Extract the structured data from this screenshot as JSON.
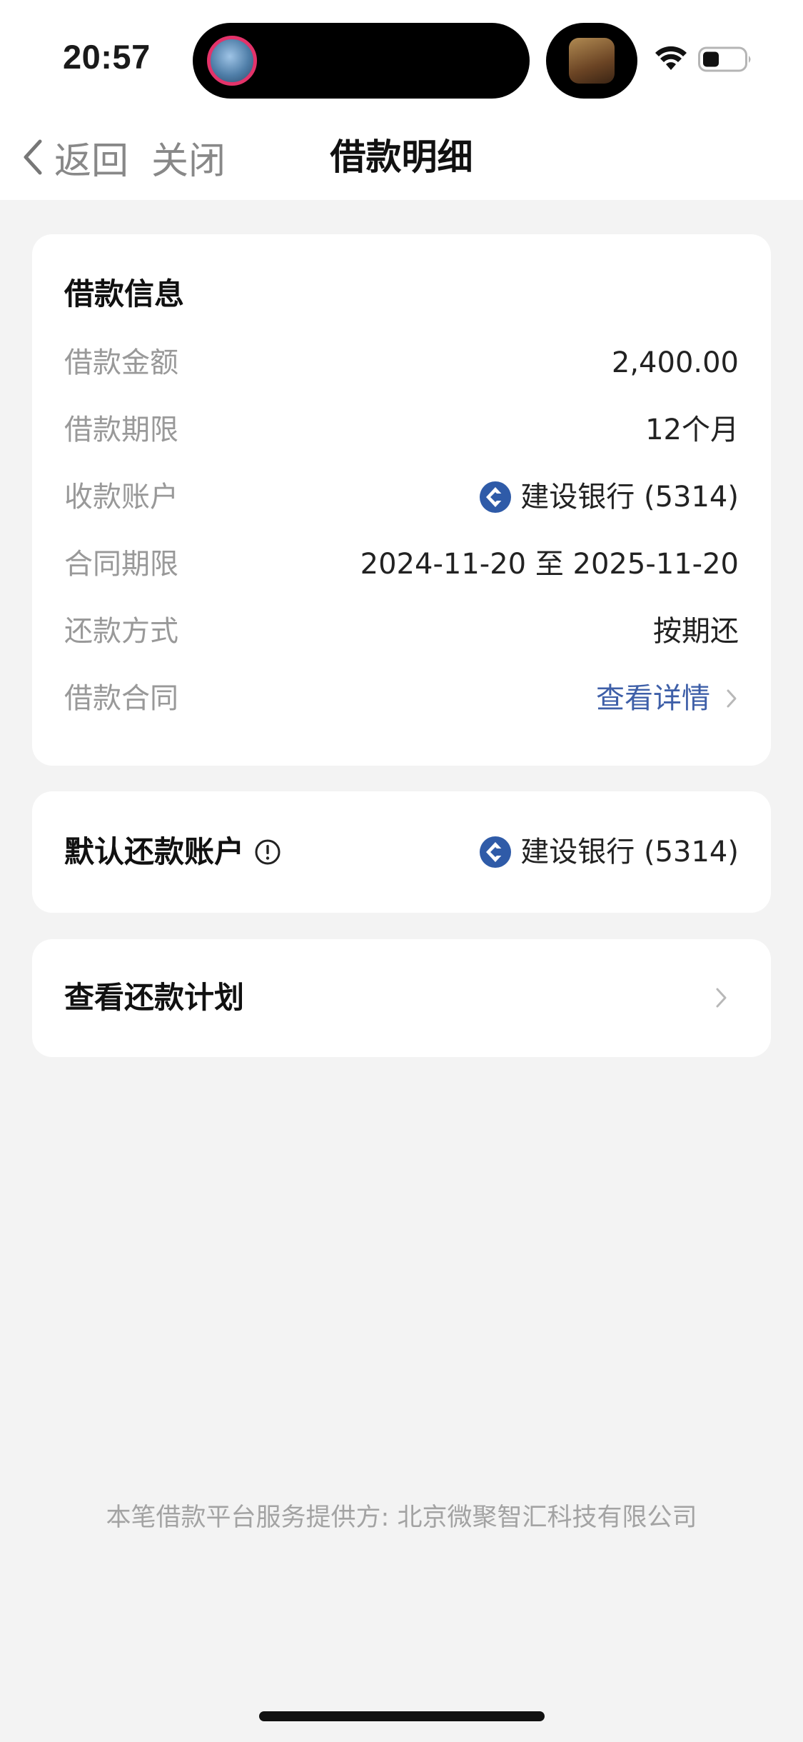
{
  "status_bar": {
    "time": "20:57"
  },
  "nav": {
    "back_label": "返回",
    "close_label": "关闭",
    "title": "借款明细"
  },
  "loan_info": {
    "title": "借款信息",
    "rows": [
      {
        "label": "借款金额",
        "value": "2,400.00"
      },
      {
        "label": "借款期限",
        "value": "12个月"
      },
      {
        "label": "收款账户",
        "value": "建设银行 (5314)",
        "icon": "ccb-bank-logo-icon"
      },
      {
        "label": "合同期限",
        "value": "2024-11-20 至 2025-11-20"
      },
      {
        "label": "还款方式",
        "value": "按期还"
      },
      {
        "label": "借款合同",
        "value": "查看详情",
        "link": true
      }
    ]
  },
  "default_account": {
    "title": "默认还款账户",
    "value": "建设银行 (5314)",
    "icon": "ccb-bank-logo-icon"
  },
  "repayment_plan": {
    "title": "查看还款计划"
  },
  "footer": {
    "text": "本笔借款平台服务提供方: 北京微聚智汇科技有限公司"
  },
  "colors": {
    "link": "#3e5fa8",
    "bank_logo": "#2f5ba8",
    "label_gray": "#999999",
    "background": "#f3f3f3"
  }
}
